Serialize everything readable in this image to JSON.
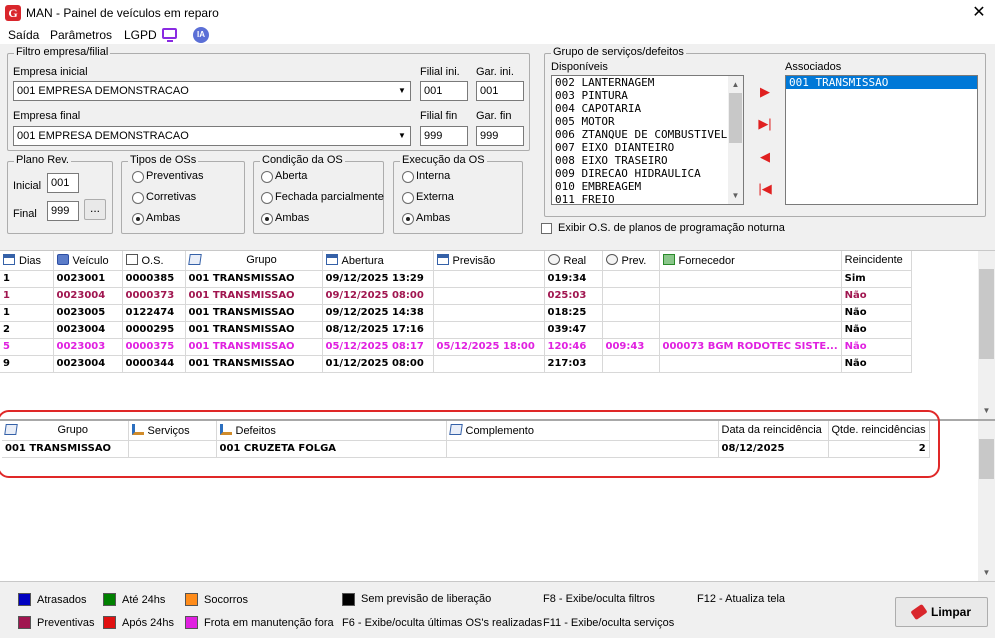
{
  "window": {
    "title": "MAN - Painel de veículos em reparo",
    "logo": "G",
    "close_glyph": "✕"
  },
  "menu": {
    "saida": "Saída",
    "parametros": "Parâmetros",
    "lgpd": "LGPD",
    "ia": "IA"
  },
  "filtro": {
    "legend": "Filtro empresa/filial",
    "empresa_inicial_label": "Empresa inicial",
    "empresa_inicial_value": "001 EMPRESA DEMONSTRACAO",
    "filial_ini_label": "Filial ini.",
    "filial_ini_value": "001",
    "gar_ini_label": "Gar. ini.",
    "gar_ini_value": "001",
    "empresa_final_label": "Empresa final",
    "empresa_final_value": "001 EMPRESA DEMONSTRACAO",
    "filial_fin_label": "Filial fin",
    "filial_fin_value": "999",
    "gar_fin_label": "Gar. fin",
    "gar_fin_value": "999"
  },
  "plano": {
    "legend": "Plano Rev.",
    "inicial_label": "Inicial",
    "inicial_value": "001",
    "final_label": "Final",
    "final_value": "999",
    "btn": "..."
  },
  "tipos": {
    "legend": "Tipos de OSs",
    "opts": [
      "Preventivas",
      "Corretivas",
      "Ambas"
    ],
    "selected": "Ambas"
  },
  "condicao": {
    "legend": "Condição da OS",
    "opts": [
      "Aberta",
      "Fechada parcialmente",
      "Ambas"
    ],
    "selected": "Ambas"
  },
  "execucao": {
    "legend": "Execução da OS",
    "opts": [
      "Interna",
      "Externa",
      "Ambas"
    ],
    "selected": "Ambas"
  },
  "grupo_servicos": {
    "legend": "Grupo de serviços/defeitos",
    "disponiveis_label": "Disponíveis",
    "disponiveis": [
      "002 LANTERNAGEM",
      "003 PINTURA",
      "004 CAPOTARIA",
      "005 MOTOR",
      "006 ZTANQUE DE COMBUSTIVEL",
      "007 EIXO DIANTEIRO",
      "008 EIXO TRASEIRO",
      "009 DIRECAO HIDRAULICA",
      "010 EMBREAGEM",
      "011 FREIO"
    ],
    "associados_label": "Associados",
    "associados": [
      "001 TRANSMISSAO"
    ],
    "exibir_label": "Exibir O.S. de planos de programação noturna"
  },
  "os_table": {
    "headers": [
      "Dias",
      "Veículo",
      "O.S.",
      "Grupo",
      "Abertura",
      "Previsão",
      "Real",
      "Prev.",
      "Fornecedor",
      "Reincidente"
    ],
    "rows": [
      {
        "color": "#000000",
        "dias": "1",
        "veiculo": "0023001",
        "os": "0000385",
        "grupo": "001  TRANSMISSAO",
        "abertura": "09/12/2025 13:29",
        "previsao": "",
        "real": "019:34",
        "prev": "",
        "fornecedor": "",
        "reincidente": "Sim"
      },
      {
        "color": "#a0154f",
        "dias": "1",
        "veiculo": "0023004",
        "os": "0000373",
        "grupo": "001  TRANSMISSAO",
        "abertura": "09/12/2025 08:00",
        "previsao": "",
        "real": "025:03",
        "prev": "",
        "fornecedor": "",
        "reincidente": "Não"
      },
      {
        "color": "#000000",
        "dias": "1",
        "veiculo": "0023005",
        "os": "0122474",
        "grupo": "001  TRANSMISSAO",
        "abertura": "09/12/2025 14:38",
        "previsao": "",
        "real": "018:25",
        "prev": "",
        "fornecedor": "",
        "reincidente": "Não"
      },
      {
        "color": "#000000",
        "dias": "2",
        "veiculo": "0023004",
        "os": "0000295",
        "grupo": "001  TRANSMISSAO",
        "abertura": "08/12/2025 17:16",
        "previsao": "",
        "real": "039:47",
        "prev": "",
        "fornecedor": "",
        "reincidente": "Não"
      },
      {
        "color": "#e020e0",
        "dias": "5",
        "veiculo": "0023003",
        "os": "0000375",
        "grupo": "001  TRANSMISSAO",
        "abertura": "05/12/2025 08:17",
        "previsao": "05/12/2025 18:00",
        "real": "120:46",
        "prev": "009:43",
        "fornecedor": "000073  BGM RODOTEC SISTE...",
        "reincidente": "Não"
      },
      {
        "color": "#000000",
        "dias": "9",
        "veiculo": "0023004",
        "os": "0000344",
        "grupo": "001  TRANSMISSAO",
        "abertura": "01/12/2025 08:00",
        "previsao": "",
        "real": "217:03",
        "prev": "",
        "fornecedor": "",
        "reincidente": "Não"
      }
    ]
  },
  "detail_table": {
    "headers": [
      "Grupo",
      "Serviços",
      "Defeitos",
      "Complemento",
      "Data da reincidência",
      "Qtde. reincidências"
    ],
    "rows": [
      {
        "grupo": "001  TRANSMISSAO",
        "servicos": "",
        "defeitos": "001  CRUZETA FOLGA",
        "complemento": "",
        "data": "08/12/2025",
        "qtde": "2"
      }
    ]
  },
  "legend": {
    "atrasados": "Atrasados",
    "ate24": "Até 24hs",
    "socorros": "Socorros",
    "sem_previsao": "Sem previsão de liberação",
    "preventivas": "Preventivas",
    "apos24": "Após 24hs",
    "frota": "Frota em manutenção fora",
    "f8": "F8 - Exibe/oculta filtros",
    "f12": "F12 - Atualiza tela",
    "f6": "F6 - Exibe/oculta últimas OS's realizadas",
    "f11": "F11 - Exibe/oculta serviços",
    "colors": {
      "atrasados": "#0000c0",
      "ate24": "#008000",
      "socorros": "#ff8c1a",
      "sem_previsao": "#000000",
      "preventivas": "#a0154f",
      "apos24": "#e01010",
      "frota": "#e020e0"
    }
  },
  "limpar_label": "Limpar"
}
